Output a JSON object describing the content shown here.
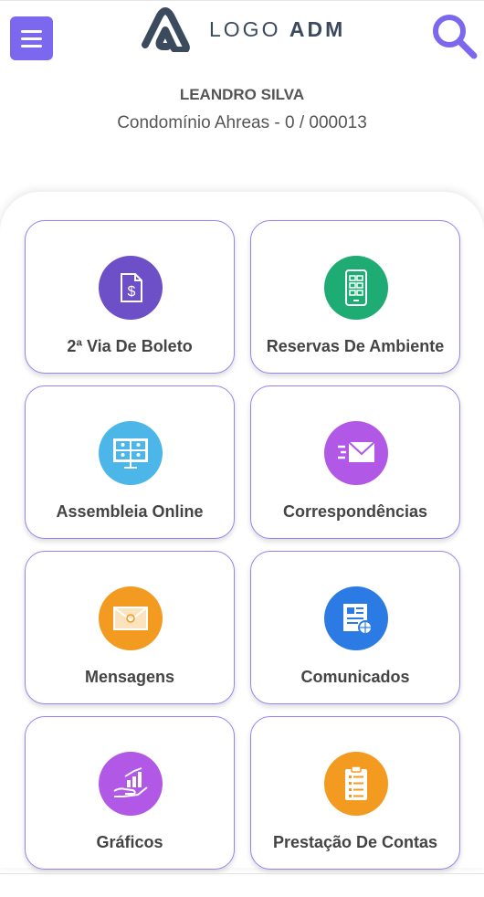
{
  "header": {
    "logo_text_light": "LOGO",
    "logo_text_bold": "ADM",
    "menu_icon": "hamburger-menu-icon",
    "search_icon": "search-icon"
  },
  "user": {
    "name": "LEANDRO SILVA",
    "condo": "Condomínio Ahreas - 0 / 000013"
  },
  "colors": {
    "accent": "#7b68ee",
    "card_border": "#9385f0"
  },
  "menu": [
    {
      "label": "2ª Via De Boleto",
      "icon": "invoice-dollar-icon",
      "color": "#6d4fc8"
    },
    {
      "label": "Reservas De Ambiente",
      "icon": "building-calendar-icon",
      "color": "#1eab74"
    },
    {
      "label": "Assembleia Online",
      "icon": "online-meeting-icon",
      "color": "#4db6e8"
    },
    {
      "label": "Correspondências",
      "icon": "envelope-fast-icon",
      "color": "#b158e6"
    },
    {
      "label": "Mensagens",
      "icon": "message-envelope-icon",
      "color": "#f39a21"
    },
    {
      "label": "Comunicados",
      "icon": "newspaper-icon",
      "color": "#2c7be5"
    },
    {
      "label": "Gráficos",
      "icon": "hand-chart-icon",
      "color": "#b158e6"
    },
    {
      "label": "Prestação De Contas",
      "icon": "clipboard-list-icon",
      "color": "#f39a21"
    }
  ]
}
